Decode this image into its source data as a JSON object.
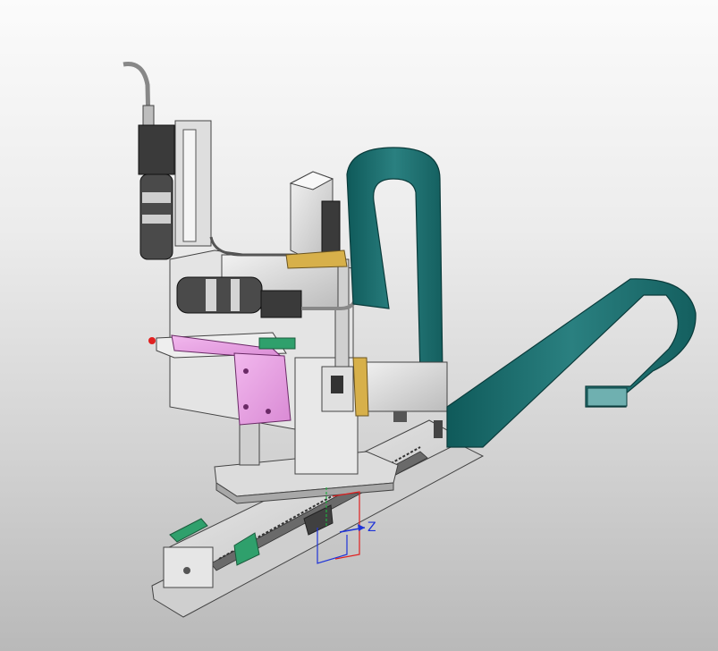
{
  "viewport": {
    "triad": {
      "z_label": "Z"
    }
  },
  "colors": {
    "background_top": "#fbfbfb",
    "background_bottom": "#b9b9b9",
    "cable_carrier": "#1f6f6f",
    "bracket_pink": "#e7a0e2",
    "rail_green": "#2f9f6b",
    "frame_gray": "#d9d9d9",
    "axis_x": "#e02020",
    "axis_y": "#20b040",
    "axis_z": "#1f34d8"
  }
}
